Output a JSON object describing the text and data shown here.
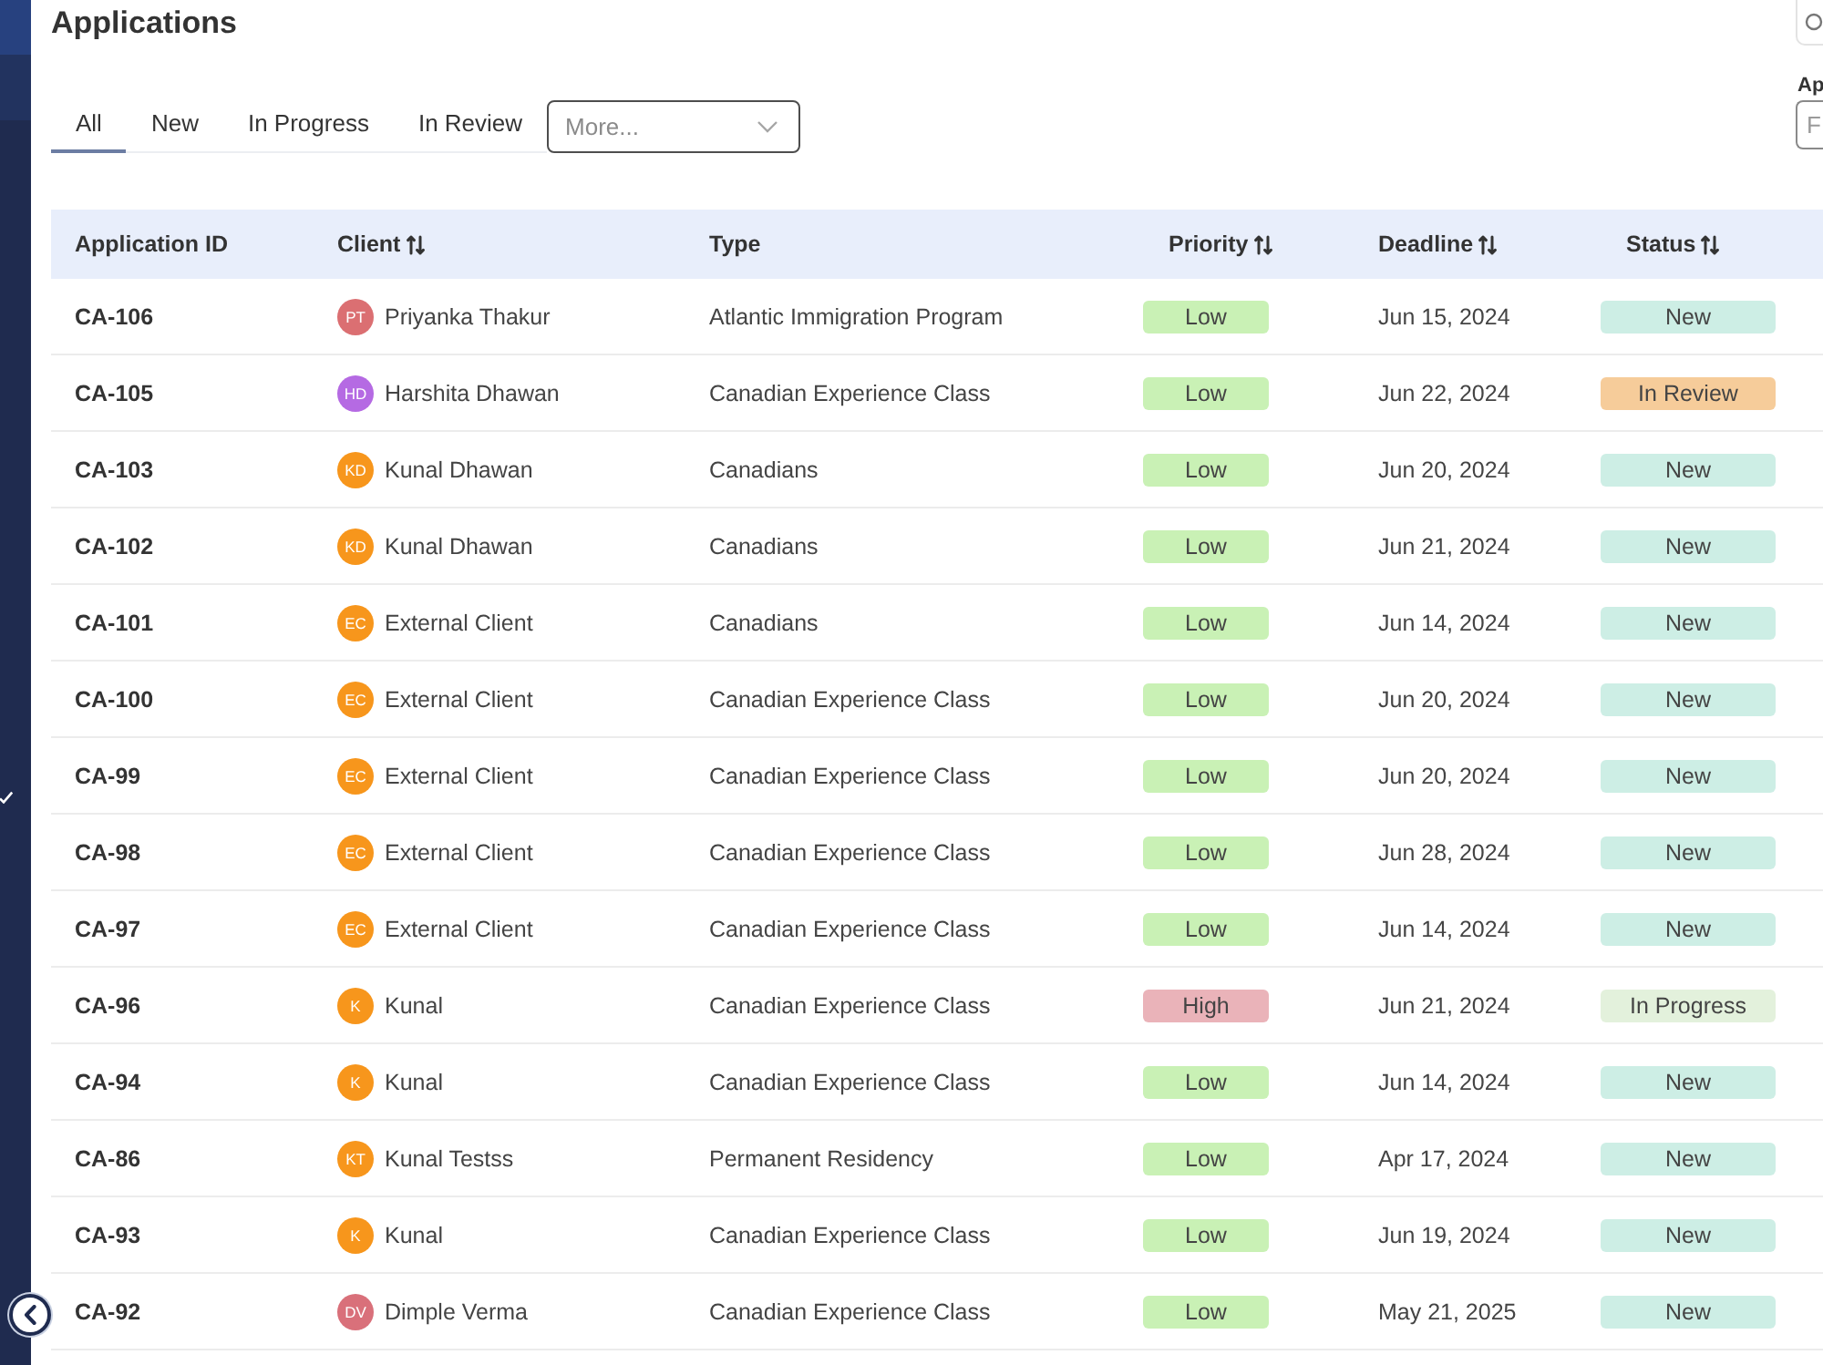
{
  "page": {
    "title": "Applications"
  },
  "sidebar": {
    "items": [
      {
        "selected": true
      },
      {
        "selected": false
      }
    ]
  },
  "tabs": [
    {
      "label": "All",
      "selected": true
    },
    {
      "label": "New",
      "selected": false
    },
    {
      "label": "In Progress",
      "selected": false
    },
    {
      "label": "In Review",
      "selected": false
    }
  ],
  "more_dropdown": {
    "placeholder": "More..."
  },
  "right_panel": {
    "label": "Ap",
    "field_placeholder": "F"
  },
  "table": {
    "columns": [
      {
        "label": "Application ID",
        "sortable": false
      },
      {
        "label": "Client",
        "sortable": true
      },
      {
        "label": "Type",
        "sortable": false
      },
      {
        "label": "Priority",
        "sortable": true
      },
      {
        "label": "Deadline",
        "sortable": true
      },
      {
        "label": "Status",
        "sortable": true
      }
    ],
    "rows": [
      {
        "id": "CA-106",
        "client": {
          "initials": "PT",
          "name": "Priyanka Thakur",
          "color": "#db6f72"
        },
        "type": "Atlantic Immigration Program",
        "priority": {
          "label": "Low",
          "color": "#c9f1b5"
        },
        "deadline": "Jun 15, 2024",
        "status": {
          "label": "New",
          "color": "#cdeee5"
        }
      },
      {
        "id": "CA-105",
        "client": {
          "initials": "HD",
          "name": "Harshita Dhawan",
          "color": "#b56ae3"
        },
        "type": "Canadian Experience Class",
        "priority": {
          "label": "Low",
          "color": "#c9f1b5"
        },
        "deadline": "Jun 22, 2024",
        "status": {
          "label": "In Review",
          "color": "#f6cc9a"
        }
      },
      {
        "id": "CA-103",
        "client": {
          "initials": "KD",
          "name": "Kunal Dhawan",
          "color": "#f7961c"
        },
        "type": "Canadians",
        "priority": {
          "label": "Low",
          "color": "#c9f1b5"
        },
        "deadline": "Jun 20, 2024",
        "status": {
          "label": "New",
          "color": "#cdeee5"
        }
      },
      {
        "id": "CA-102",
        "client": {
          "initials": "KD",
          "name": "Kunal Dhawan",
          "color": "#f7961c"
        },
        "type": "Canadians",
        "priority": {
          "label": "Low",
          "color": "#c9f1b5"
        },
        "deadline": "Jun 21, 2024",
        "status": {
          "label": "New",
          "color": "#cdeee5"
        }
      },
      {
        "id": "CA-101",
        "client": {
          "initials": "EC",
          "name": "External Client",
          "color": "#f7961c"
        },
        "type": "Canadians",
        "priority": {
          "label": "Low",
          "color": "#c9f1b5"
        },
        "deadline": "Jun 14, 2024",
        "status": {
          "label": "New",
          "color": "#cdeee5"
        }
      },
      {
        "id": "CA-100",
        "client": {
          "initials": "EC",
          "name": "External Client",
          "color": "#f7961c"
        },
        "type": "Canadian Experience Class",
        "priority": {
          "label": "Low",
          "color": "#c9f1b5"
        },
        "deadline": "Jun 20, 2024",
        "status": {
          "label": "New",
          "color": "#cdeee5"
        }
      },
      {
        "id": "CA-99",
        "client": {
          "initials": "EC",
          "name": "External Client",
          "color": "#f7961c"
        },
        "type": "Canadian Experience Class",
        "priority": {
          "label": "Low",
          "color": "#c9f1b5"
        },
        "deadline": "Jun 20, 2024",
        "status": {
          "label": "New",
          "color": "#cdeee5"
        }
      },
      {
        "id": "CA-98",
        "client": {
          "initials": "EC",
          "name": "External Client",
          "color": "#f7961c"
        },
        "type": "Canadian Experience Class",
        "priority": {
          "label": "Low",
          "color": "#c9f1b5"
        },
        "deadline": "Jun 28, 2024",
        "status": {
          "label": "New",
          "color": "#cdeee5"
        }
      },
      {
        "id": "CA-97",
        "client": {
          "initials": "EC",
          "name": "External Client",
          "color": "#f7961c"
        },
        "type": "Canadian Experience Class",
        "priority": {
          "label": "Low",
          "color": "#c9f1b5"
        },
        "deadline": "Jun 14, 2024",
        "status": {
          "label": "New",
          "color": "#cdeee5"
        }
      },
      {
        "id": "CA-96",
        "client": {
          "initials": "K",
          "name": "Kunal",
          "color": "#f7961c"
        },
        "type": "Canadian Experience Class",
        "priority": {
          "label": "High",
          "color": "#eab3b9"
        },
        "deadline": "Jun 21, 2024",
        "status": {
          "label": "In Progress",
          "color": "#e3f1dc"
        }
      },
      {
        "id": "CA-94",
        "client": {
          "initials": "K",
          "name": "Kunal",
          "color": "#f7961c"
        },
        "type": "Canadian Experience Class",
        "priority": {
          "label": "Low",
          "color": "#c9f1b5"
        },
        "deadline": "Jun 14, 2024",
        "status": {
          "label": "New",
          "color": "#cdeee5"
        }
      },
      {
        "id": "CA-86",
        "client": {
          "initials": "KT",
          "name": "Kunal Testss",
          "color": "#f7961c"
        },
        "type": "Permanent Residency",
        "priority": {
          "label": "Low",
          "color": "#c9f1b5"
        },
        "deadline": "Apr 17, 2024",
        "status": {
          "label": "New",
          "color": "#cdeee5"
        }
      },
      {
        "id": "CA-93",
        "client": {
          "initials": "K",
          "name": "Kunal",
          "color": "#f7961c"
        },
        "type": "Canadian Experience Class",
        "priority": {
          "label": "Low",
          "color": "#c9f1b5"
        },
        "deadline": "Jun 19, 2024",
        "status": {
          "label": "New",
          "color": "#cdeee5"
        }
      },
      {
        "id": "CA-92",
        "client": {
          "initials": "DV",
          "name": "Dimple Verma",
          "color": "#d9707a"
        },
        "type": "Canadian Experience Class",
        "priority": {
          "label": "Low",
          "color": "#c9f1b5"
        },
        "deadline": "May 21, 2025",
        "status": {
          "label": "New",
          "color": "#cdeee5"
        }
      }
    ]
  }
}
